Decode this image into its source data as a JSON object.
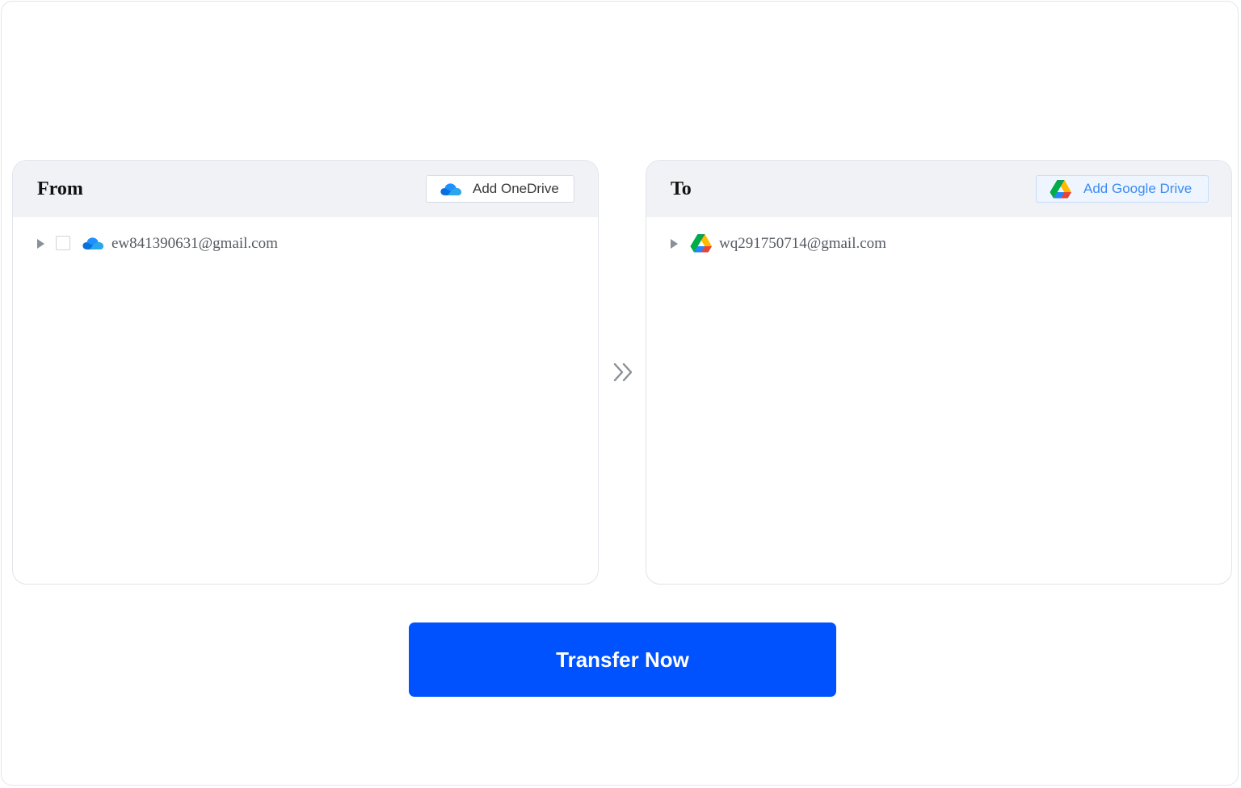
{
  "from_panel": {
    "title": "From",
    "add_button_label": "Add OneDrive",
    "add_button_icon": "onedrive-cloud-icon",
    "accounts": [
      {
        "email": "ew841390631@gmail.com",
        "icon": "onedrive-cloud-icon",
        "checked": false
      }
    ]
  },
  "to_panel": {
    "title": "To",
    "add_button_label": "Add Google Drive",
    "add_button_icon": "google-drive-icon",
    "accounts": [
      {
        "email": "wq291750714@gmail.com",
        "icon": "google-drive-icon"
      }
    ]
  },
  "middle_icon": "double-chevron-right-icon",
  "transfer_button_label": "Transfer Now",
  "colors": {
    "primary": "#0052ff",
    "onedrive_blue": "#0a6fdc",
    "gdrive_blue": "#3b8cf0",
    "panel_header_bg": "#f0f2f6"
  }
}
